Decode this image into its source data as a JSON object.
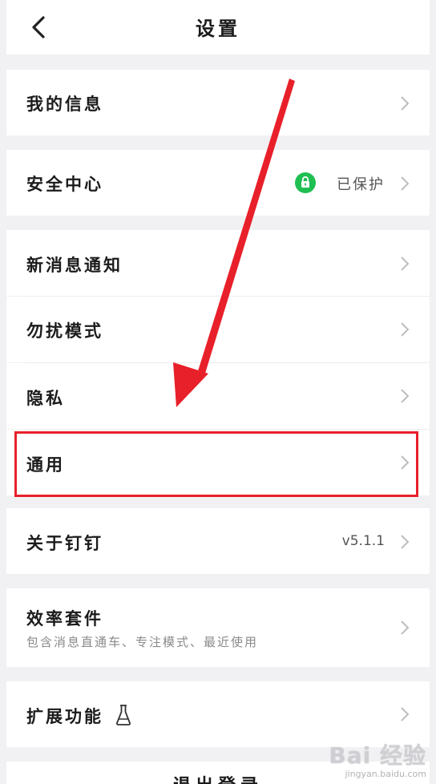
{
  "header": {
    "title": "设置",
    "back_icon": "chevron-left-icon"
  },
  "rows": {
    "my_info": {
      "label": "我的信息"
    },
    "security": {
      "label": "安全中心",
      "value": "已保护",
      "icon": "lock-icon",
      "icon_color": "#1fbf52"
    },
    "notifications": {
      "label": "新消息通知"
    },
    "dnd": {
      "label": "勿扰模式"
    },
    "privacy": {
      "label": "隐私"
    },
    "general": {
      "label": "通用"
    },
    "about": {
      "label": "关于钉钉",
      "value": "v5.1.1"
    },
    "efficiency": {
      "label": "效率套件",
      "sublabel": "包含消息直通车、专注模式、最近使用"
    },
    "extensions": {
      "label": "扩展功能",
      "icon": "flask-icon"
    },
    "logout": {
      "label": "退出登录"
    }
  },
  "annotation": {
    "highlight_color": "#e8202a"
  },
  "watermark": {
    "main": "Bai 经验",
    "sub": "jingyan.baidu.com"
  }
}
